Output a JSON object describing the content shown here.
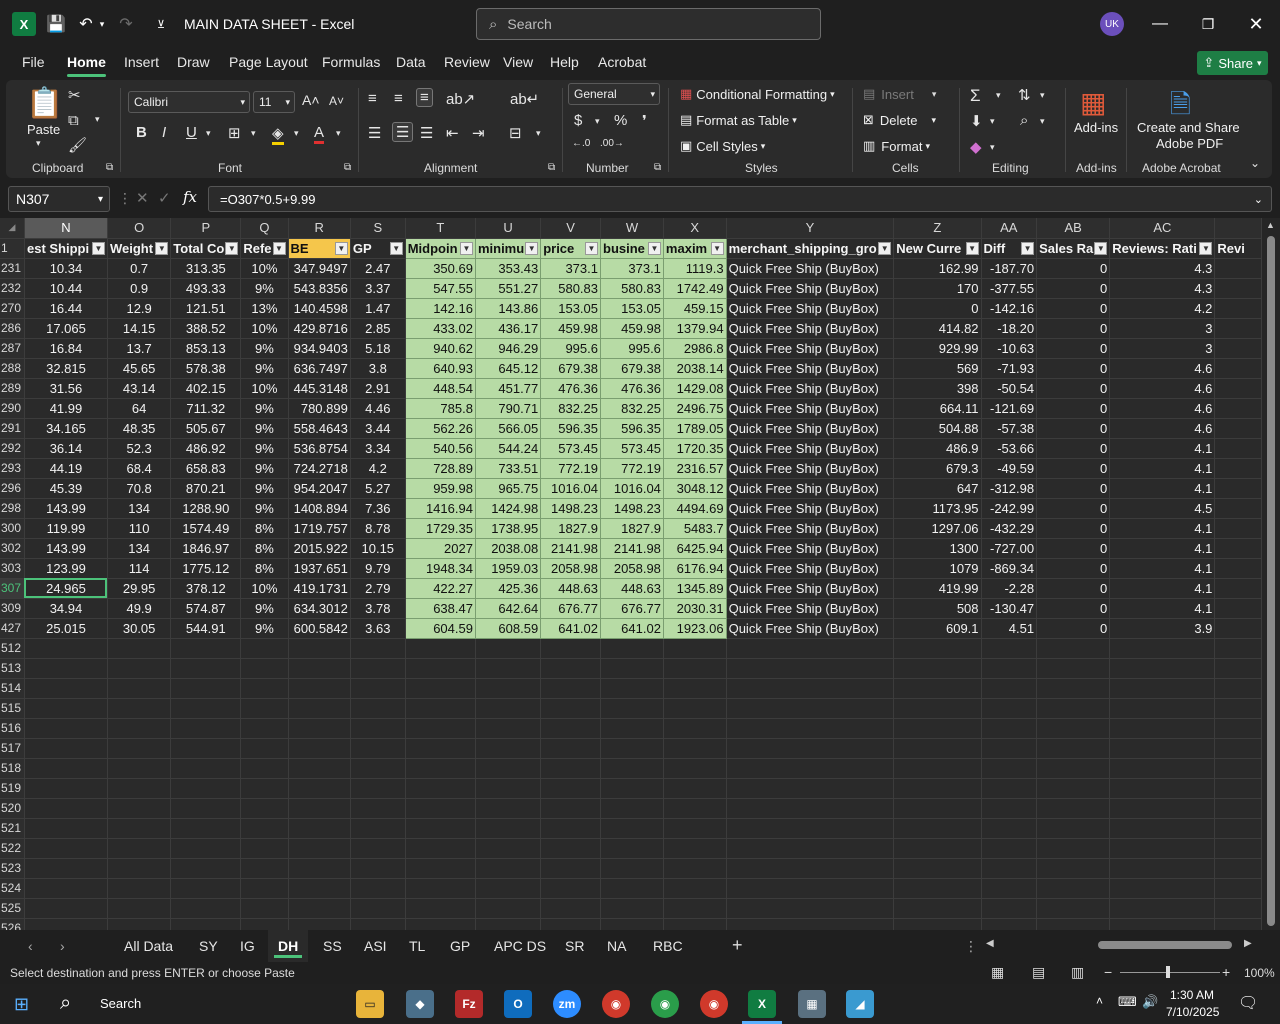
{
  "window": {
    "title": "MAIN DATA SHEET  -  Excel",
    "app_icon": "X",
    "search_placeholder": "Search",
    "user_initials": "UK"
  },
  "menu": {
    "items": [
      "File",
      "Home",
      "Insert",
      "Draw",
      "Page Layout",
      "Formulas",
      "Data",
      "Review",
      "View",
      "Help",
      "Acrobat"
    ],
    "active": "Home",
    "share": "Share"
  },
  "ribbon": {
    "clipboard": {
      "paste": "Paste",
      "label": "Clipboard"
    },
    "font": {
      "name": "Calibri",
      "size": "11",
      "label": "Font"
    },
    "alignment": {
      "label": "Alignment"
    },
    "number": {
      "format": "General",
      "label": "Number"
    },
    "styles": {
      "conditional": "Conditional Formatting",
      "table": "Format as Table",
      "cell": "Cell Styles",
      "label": "Styles"
    },
    "cells": {
      "insert": "Insert",
      "delete": "Delete",
      "format": "Format",
      "label": "Cells"
    },
    "editing": {
      "label": "Editing"
    },
    "addins": {
      "button": "Add-ins",
      "label": "Add-ins"
    },
    "acrobat": {
      "button_line1": "Create and Share",
      "button_line2": "Adobe PDF",
      "label": "Adobe Acrobat"
    }
  },
  "formula_bar": {
    "cell_ref": "N307",
    "formula": "=O307*0.5+9.99"
  },
  "columns": [
    "N",
    "O",
    "P",
    "Q",
    "R",
    "S",
    "T",
    "U",
    "V",
    "W",
    "X",
    "Y",
    "Z",
    "AA",
    "AB",
    "AC",
    ""
  ],
  "headers": [
    "est Shippi",
    "Weight",
    "Total Co",
    "Refe",
    "BE",
    "GP",
    "Midpoin",
    "minimu",
    "price",
    "busine",
    "maxim",
    "merchant_shipping_gro",
    "New Curre",
    "Diff",
    "Sales Ra",
    "Reviews: Rati",
    "Revi"
  ],
  "rows": [
    {
      "n": "231",
      "c": [
        "10.34",
        "0.7",
        "313.35",
        "10%",
        "347.9497",
        "2.47",
        "350.69",
        "353.43",
        "373.1",
        "373.1",
        "1119.3",
        "Quick Free Ship (BuyBox)",
        "162.99",
        "-187.70",
        "0",
        "4.3",
        ""
      ]
    },
    {
      "n": "232",
      "c": [
        "10.44",
        "0.9",
        "493.33",
        "9%",
        "543.8356",
        "3.37",
        "547.55",
        "551.27",
        "580.83",
        "580.83",
        "1742.49",
        "Quick Free Ship (BuyBox)",
        "170",
        "-377.55",
        "0",
        "4.3",
        ""
      ]
    },
    {
      "n": "270",
      "c": [
        "16.44",
        "12.9",
        "121.51",
        "13%",
        "140.4598",
        "1.47",
        "142.16",
        "143.86",
        "153.05",
        "153.05",
        "459.15",
        "Quick Free Ship (BuyBox)",
        "0",
        "-142.16",
        "0",
        "4.2",
        ""
      ]
    },
    {
      "n": "286",
      "c": [
        "17.065",
        "14.15",
        "388.52",
        "10%",
        "429.8716",
        "2.85",
        "433.02",
        "436.17",
        "459.98",
        "459.98",
        "1379.94",
        "Quick Free Ship (BuyBox)",
        "414.82",
        "-18.20",
        "0",
        "3",
        ""
      ]
    },
    {
      "n": "287",
      "c": [
        "16.84",
        "13.7",
        "853.13",
        "9%",
        "934.9403",
        "5.18",
        "940.62",
        "946.29",
        "995.6",
        "995.6",
        "2986.8",
        "Quick Free Ship (BuyBox)",
        "929.99",
        "-10.63",
        "0",
        "3",
        ""
      ]
    },
    {
      "n": "288",
      "c": [
        "32.815",
        "45.65",
        "578.38",
        "9%",
        "636.7497",
        "3.8",
        "640.93",
        "645.12",
        "679.38",
        "679.38",
        "2038.14",
        "Quick Free Ship (BuyBox)",
        "569",
        "-71.93",
        "0",
        "4.6",
        ""
      ]
    },
    {
      "n": "289",
      "c": [
        "31.56",
        "43.14",
        "402.15",
        "10%",
        "445.3148",
        "2.91",
        "448.54",
        "451.77",
        "476.36",
        "476.36",
        "1429.08",
        "Quick Free Ship (BuyBox)",
        "398",
        "-50.54",
        "0",
        "4.6",
        ""
      ]
    },
    {
      "n": "290",
      "c": [
        "41.99",
        "64",
        "711.32",
        "9%",
        "780.899",
        "4.46",
        "785.8",
        "790.71",
        "832.25",
        "832.25",
        "2496.75",
        "Quick Free Ship (BuyBox)",
        "664.11",
        "-121.69",
        "0",
        "4.6",
        ""
      ]
    },
    {
      "n": "291",
      "c": [
        "34.165",
        "48.35",
        "505.67",
        "9%",
        "558.4643",
        "3.44",
        "562.26",
        "566.05",
        "596.35",
        "596.35",
        "1789.05",
        "Quick Free Ship (BuyBox)",
        "504.88",
        "-57.38",
        "0",
        "4.6",
        ""
      ]
    },
    {
      "n": "292",
      "c": [
        "36.14",
        "52.3",
        "486.92",
        "9%",
        "536.8754",
        "3.34",
        "540.56",
        "544.24",
        "573.45",
        "573.45",
        "1720.35",
        "Quick Free Ship (BuyBox)",
        "486.9",
        "-53.66",
        "0",
        "4.1",
        ""
      ]
    },
    {
      "n": "293",
      "c": [
        "44.19",
        "68.4",
        "658.83",
        "9%",
        "724.2718",
        "4.2",
        "728.89",
        "733.51",
        "772.19",
        "772.19",
        "2316.57",
        "Quick Free Ship (BuyBox)",
        "679.3",
        "-49.59",
        "0",
        "4.1",
        ""
      ]
    },
    {
      "n": "296",
      "c": [
        "45.39",
        "70.8",
        "870.21",
        "9%",
        "954.2047",
        "5.27",
        "959.98",
        "965.75",
        "1016.04",
        "1016.04",
        "3048.12",
        "Quick Free Ship (BuyBox)",
        "647",
        "-312.98",
        "0",
        "4.1",
        ""
      ]
    },
    {
      "n": "298",
      "c": [
        "143.99",
        "134",
        "1288.90",
        "9%",
        "1408.894",
        "7.36",
        "1416.94",
        "1424.98",
        "1498.23",
        "1498.23",
        "4494.69",
        "Quick Free Ship (BuyBox)",
        "1173.95",
        "-242.99",
        "0",
        "4.5",
        ""
      ]
    },
    {
      "n": "300",
      "c": [
        "119.99",
        "110",
        "1574.49",
        "8%",
        "1719.757",
        "8.78",
        "1729.35",
        "1738.95",
        "1827.9",
        "1827.9",
        "5483.7",
        "Quick Free Ship (BuyBox)",
        "1297.06",
        "-432.29",
        "0",
        "4.1",
        ""
      ]
    },
    {
      "n": "302",
      "c": [
        "143.99",
        "134",
        "1846.97",
        "8%",
        "2015.922",
        "10.15",
        "2027",
        "2038.08",
        "2141.98",
        "2141.98",
        "6425.94",
        "Quick Free Ship (BuyBox)",
        "1300",
        "-727.00",
        "0",
        "4.1",
        ""
      ]
    },
    {
      "n": "303",
      "c": [
        "123.99",
        "114",
        "1775.12",
        "8%",
        "1937.651",
        "9.79",
        "1948.34",
        "1959.03",
        "2058.98",
        "2058.98",
        "6176.94",
        "Quick Free Ship (BuyBox)",
        "1079",
        "-869.34",
        "0",
        "4.1",
        ""
      ]
    },
    {
      "n": "307",
      "c": [
        "24.965",
        "29.95",
        "378.12",
        "10%",
        "419.1731",
        "2.79",
        "422.27",
        "425.36",
        "448.63",
        "448.63",
        "1345.89",
        "Quick Free Ship (BuyBox)",
        "419.99",
        "-2.28",
        "0",
        "4.1",
        ""
      ]
    },
    {
      "n": "309",
      "c": [
        "34.94",
        "49.9",
        "574.87",
        "9%",
        "634.3012",
        "3.78",
        "638.47",
        "642.64",
        "676.77",
        "676.77",
        "2030.31",
        "Quick Free Ship (BuyBox)",
        "508",
        "-130.47",
        "0",
        "4.1",
        ""
      ]
    },
    {
      "n": "427",
      "c": [
        "25.015",
        "30.05",
        "544.91",
        "9%",
        "600.5842",
        "3.63",
        "604.59",
        "608.59",
        "641.02",
        "641.02",
        "1923.06",
        "Quick Free Ship (BuyBox)",
        "609.1",
        "4.51",
        "0",
        "3.9",
        ""
      ]
    }
  ],
  "empty_rows": [
    "512",
    "513",
    "514",
    "515",
    "516",
    "517",
    "518",
    "519",
    "520",
    "521",
    "522",
    "523",
    "524",
    "525",
    "526"
  ],
  "sheet_tabs": [
    "All Data",
    "SY",
    "IG",
    "DH",
    "SS",
    "ASI",
    "TL",
    "GP",
    "APC DS",
    "SR",
    "NA",
    "RBC"
  ],
  "active_sheet": "DH",
  "status": {
    "message": "Select destination and press ENTER or choose Paste",
    "zoom": "100%"
  },
  "taskbar": {
    "search": "Search",
    "time": "1:30 AM",
    "date": "7/10/2025"
  },
  "colors": {
    "accent_green": "#4cc27a",
    "excel_green": "#107c41",
    "highlight_yellow": "#f5c64b",
    "highlight_green": "#b7dba5"
  }
}
